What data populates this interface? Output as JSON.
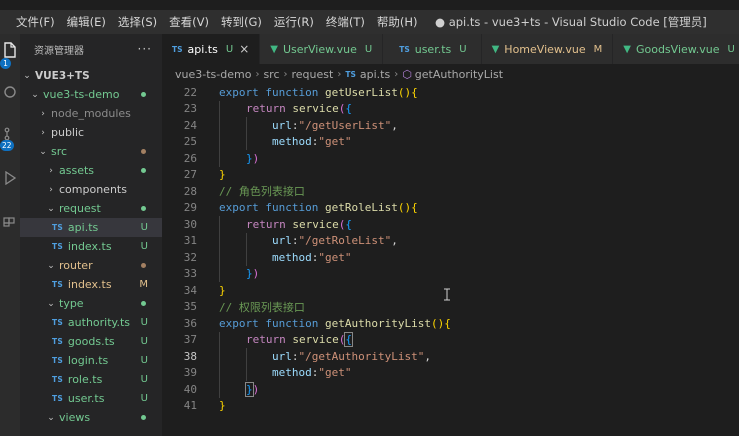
{
  "menu": [
    "文件(F)",
    "编辑(E)",
    "选择(S)",
    "查看(V)",
    "转到(G)",
    "运行(R)",
    "终端(T)",
    "帮助(H)"
  ],
  "window_title": "● api.ts - vue3+ts - Visual Studio Code [管理员]",
  "activity": {
    "explorer_badge": "1",
    "scm_badge": "22"
  },
  "explorer": {
    "title": "资源管理器",
    "more": "···",
    "items": [
      {
        "label": "VUE3+TS",
        "kind": "section",
        "status": ""
      },
      {
        "label": "vue3-ts-demo",
        "kind": "folder",
        "status": "dot"
      },
      {
        "label": "node_modules",
        "kind": "folder",
        "status": ""
      },
      {
        "label": "public",
        "kind": "folder",
        "status": ""
      },
      {
        "label": "src",
        "kind": "folder",
        "status": "dot"
      },
      {
        "label": "assets",
        "kind": "folder",
        "status": "dot"
      },
      {
        "label": "components",
        "kind": "folder",
        "status": ""
      },
      {
        "label": "request",
        "kind": "folder",
        "status": "dot"
      },
      {
        "label": "api.ts",
        "kind": "file",
        "status": "U"
      },
      {
        "label": "index.ts",
        "kind": "file",
        "status": "U"
      },
      {
        "label": "router",
        "kind": "folder",
        "status": "dot"
      },
      {
        "label": "index.ts",
        "kind": "file",
        "status": "M"
      },
      {
        "label": "type",
        "kind": "folder",
        "status": "dot"
      },
      {
        "label": "authority.ts",
        "kind": "file",
        "status": "U"
      },
      {
        "label": "goods.ts",
        "kind": "file",
        "status": "U"
      },
      {
        "label": "login.ts",
        "kind": "file",
        "status": "U"
      },
      {
        "label": "role.ts",
        "kind": "file",
        "status": "U"
      },
      {
        "label": "user.ts",
        "kind": "file",
        "status": "U"
      },
      {
        "label": "views",
        "kind": "folder",
        "status": "dot"
      }
    ],
    "ts_tag": "TS"
  },
  "tabs": [
    {
      "label": "api.ts",
      "icon": "TS",
      "status": "U",
      "close": "×"
    },
    {
      "label": "UserView.vue",
      "icon": "V",
      "status": "U"
    },
    {
      "label": "user.ts",
      "icon": "TS",
      "status": "U"
    },
    {
      "label": "HomeView.vue",
      "icon": "V",
      "status": "M"
    },
    {
      "label": "GoodsView.vue",
      "icon": "V",
      "status": "U"
    }
  ],
  "breadcrumb": [
    "vue3-ts-demo",
    "src",
    "request",
    "api.ts",
    "getAuthorityList"
  ],
  "editor": {
    "line_numbers": [
      "22",
      "23",
      "24",
      "25",
      "26",
      "27",
      "28",
      "29",
      "30",
      "31",
      "32",
      "33",
      "34",
      "35",
      "36",
      "37",
      "38",
      "39",
      "40",
      "41"
    ],
    "current_line": "38",
    "t": {
      "export": "export",
      "function": "function",
      "return": "return",
      "service": "service",
      "url_key": "url",
      "method_key": "method",
      "get": "\"get\"",
      "colon": ":",
      "comma": ",",
      "open_paren": "(",
      "close_paren": ")",
      "open_brace": "{",
      "close_brace": "}",
      "fn_user": "getUserList",
      "fn_role": "getRoleList",
      "fn_auth": "getAuthorityList",
      "url_user": "\"/getUserList\"",
      "url_role": "\"/getRoleList\"",
      "url_auth": "\"/getAuthorityList\"",
      "comment_role": "// 角色列表接口",
      "comment_auth": "// 权限列表接口"
    }
  }
}
